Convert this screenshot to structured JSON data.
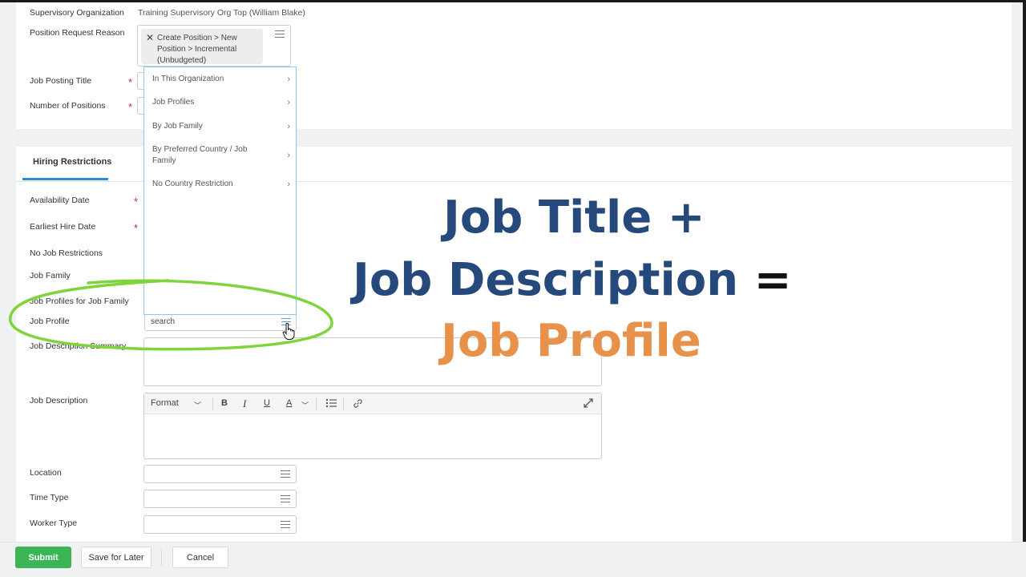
{
  "form_top": {
    "supervisory_org_label": "Supervisory Organization",
    "supervisory_org_value": "Training Supervisory Org Top (William Blake)",
    "position_request_reason_label": "Position Request Reason",
    "position_request_reason_value": "Create Position > New Position > Incremental (Unbudgeted)",
    "job_posting_title_label": "Job Posting Title",
    "number_of_positions_label": "Number of Positions",
    "required_marker": "*"
  },
  "dropdown": {
    "items": [
      {
        "label": "In This Organization"
      },
      {
        "label": "Job Profiles"
      },
      {
        "label": "By Job Family"
      },
      {
        "label": "By Preferred Country / Job Family"
      },
      {
        "label": "No Country Restriction"
      }
    ],
    "chevron": "›"
  },
  "tabs": {
    "active": "Hiring Restrictions"
  },
  "hiring": {
    "availability_date_label": "Availability Date",
    "earliest_hire_date_label": "Earliest Hire Date",
    "no_job_restrictions_label": "No Job Restrictions",
    "job_family_label": "Job Family",
    "job_profiles_for_family_label": "Job Profiles for Job Family",
    "job_profile_label": "Job Profile",
    "job_profile_input_value": "search",
    "job_description_summary_label": "Job Description Summary",
    "job_description_label": "Job Description",
    "location_label": "Location",
    "time_type_label": "Time Type",
    "worker_type_label": "Worker Type"
  },
  "editor_toolbar": {
    "format_label": "Format",
    "bold": "B",
    "italic": "I",
    "underline": "U",
    "font_color": "A"
  },
  "footer": {
    "submit": "Submit",
    "save_for_later": "Save for Later",
    "cancel": "Cancel"
  },
  "overlay": {
    "line1": "Job Title +",
    "line2a": "Job Description",
    "line2b": " =",
    "line3": "Job Profile",
    "colors": {
      "navy": "#25497a",
      "orange": "#e8914a",
      "black": "#111111",
      "green_ellipse": "#7fd43b"
    }
  }
}
